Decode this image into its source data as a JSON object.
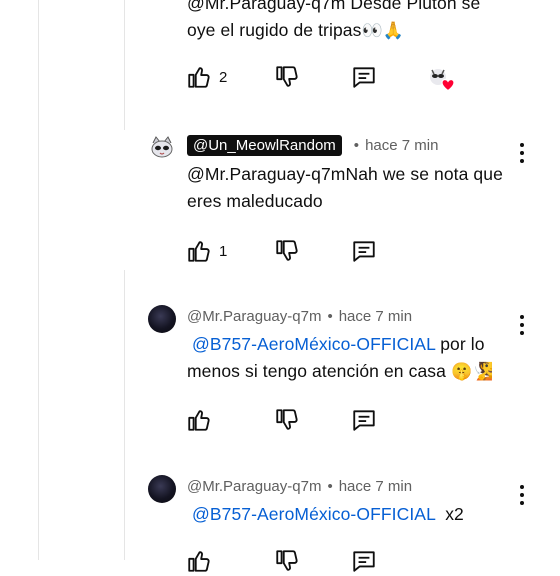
{
  "comments": [
    {
      "author": "@Mr.Paraguay-q7m",
      "text_part1": "@Mr.Paraguay-q7m Desde Plutón se",
      "text_part2": "oye el rugido de tripas",
      "emoji": "👀🙏",
      "likes": "2"
    },
    {
      "author": "@Un_MeowlRandom",
      "time": "hace 7 min",
      "text": "@Mr.Paraguay-q7mNah we se nota que eres maleducado",
      "likes": "1"
    },
    {
      "author": "@Mr.Paraguay-q7m",
      "time": "hace 7 min",
      "mention": "@B757-AeroMéxico-OFFICIAL",
      "text_after": " por lo menos si tengo atención en casa ",
      "emoji": "🤫🧏"
    },
    {
      "author": "@Mr.Paraguay-q7m",
      "time": "hace 7 min",
      "mention": "@B757-AeroMéxico-OFFICIAL",
      "text_after": "  x2"
    }
  ],
  "icons": {
    "like": "thumbs-up-icon",
    "dislike": "thumbs-down-icon",
    "reply": "reply-icon",
    "more": "more-vert-icon",
    "creator_heart": "creator-heart-icon"
  },
  "colors": {
    "link": "#065fd4",
    "meta": "#606060",
    "heart": "#ff0033",
    "chip_bg": "#0f0f0f"
  }
}
